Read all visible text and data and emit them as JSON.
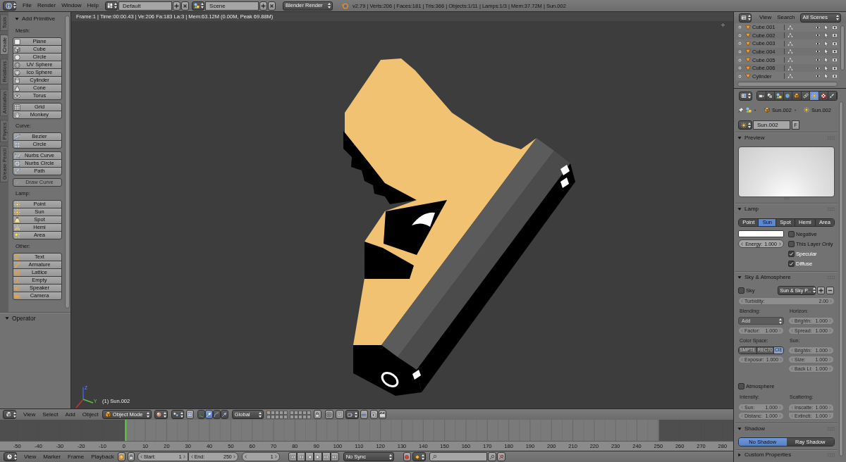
{
  "top_bar": {
    "menus": [
      "File",
      "Render",
      "Window",
      "Help"
    ],
    "screen_layout": "Default",
    "scene": "Scene",
    "render_engine": "Blender Render",
    "stats": "v2.79 | Verts:206 | Faces:181 | Tris:366 | Objects:1/11 | Lamps:1/3 | Mem:37.72M | Sun.002"
  },
  "tool_shelf": {
    "tabs": [
      {
        "label": "Tools",
        "selected": false
      },
      {
        "label": "Create",
        "selected": true
      },
      {
        "label": "Relations",
        "selected": false
      },
      {
        "label": "Animation",
        "selected": false
      },
      {
        "label": "Physics",
        "selected": false
      },
      {
        "label": "Grease Pencil",
        "selected": false
      }
    ],
    "add_primitive": {
      "title": "Add Primitive",
      "expanded": true,
      "groups": [
        {
          "label": "Mesh:",
          "blocks": [
            [
              {
                "label": "Plane",
                "disabled": false
              },
              {
                "label": "Cube",
                "disabled": false
              },
              {
                "label": "Circle",
                "disabled": false
              },
              {
                "label": "UV Sphere",
                "disabled": false
              },
              {
                "label": "Ico Sphere",
                "disabled": false
              },
              {
                "label": "Cylinder",
                "disabled": false
              },
              {
                "label": "Cone",
                "disabled": false
              },
              {
                "label": "Torus",
                "disabled": false
              }
            ],
            [
              {
                "label": "Grid",
                "disabled": false
              },
              {
                "label": "Monkey",
                "disabled": false
              }
            ]
          ]
        },
        {
          "label": "Curve:",
          "blocks": [
            [
              {
                "label": "Bezier",
                "disabled": false
              },
              {
                "label": "Circle",
                "disabled": false
              }
            ],
            [
              {
                "label": "Nurbs Curve",
                "disabled": false
              },
              {
                "label": "Nurbs Circle",
                "disabled": false
              },
              {
                "label": "Path",
                "disabled": false
              }
            ],
            [
              {
                "label": "Draw Curve",
                "disabled": true
              }
            ]
          ]
        },
        {
          "label": "Lamp:",
          "blocks": [
            [
              {
                "label": "Point",
                "disabled": false
              },
              {
                "label": "Sun",
                "disabled": false
              },
              {
                "label": "Spot",
                "disabled": false
              },
              {
                "label": "Hemi",
                "disabled": false
              },
              {
                "label": "Area",
                "disabled": false
              }
            ]
          ]
        },
        {
          "label": "Other:",
          "blocks": [
            [
              {
                "label": "Text",
                "disabled": false
              },
              {
                "label": "Armature",
                "disabled": false
              },
              {
                "label": "Lattice",
                "disabled": false
              },
              {
                "label": "Empty",
                "disabled": false
              },
              {
                "label": "Speaker",
                "disabled": false
              },
              {
                "label": "Camera",
                "disabled": false
              }
            ]
          ]
        }
      ]
    },
    "operator": {
      "title": "Operator",
      "expanded": true
    }
  },
  "viewport": {
    "info": "Frame:1 | Time:00:00.43 | Ve:206 Fa:183 La:3 | Mem:63.12M (0.00M, Peak 69.88M)",
    "axes": [
      "Z",
      "Y"
    ],
    "object_label": "(1) Sun.002"
  },
  "view3d_header": {
    "menus": [
      "View",
      "Select",
      "Add",
      "Object"
    ],
    "mode": "Object Mode",
    "toggles": [
      {
        "selected": false
      },
      {
        "selected": false
      },
      {
        "selected": true
      },
      {
        "selected": false
      },
      {
        "selected": false
      }
    ],
    "orientation": "Global",
    "layers": [
      {
        "occupied": true
      },
      {
        "occupied": false
      },
      {
        "occupied": false
      },
      {
        "occupied": false
      },
      {
        "occupied": false
      },
      {
        "occupied": false
      },
      {
        "occupied": false
      },
      {
        "occupied": false
      },
      {
        "occupied": false
      },
      {
        "occupied": false
      },
      {
        "occupied": false
      },
      {
        "occupied": false
      },
      {
        "occupied": false
      },
      {
        "occupied": false
      },
      {
        "occupied": false
      },
      {
        "occupied": false
      },
      {
        "occupied": false
      },
      {
        "occupied": false
      },
      {
        "occupied": false
      },
      {
        "occupied": false
      }
    ]
  },
  "timeline": {
    "ruler": [
      "-50",
      "-40",
      "-30",
      "-20",
      "-10",
      "0",
      "10",
      "20",
      "30",
      "40",
      "50",
      "60",
      "70",
      "80",
      "90",
      "100",
      "110",
      "120",
      "130",
      "140",
      "150",
      "160",
      "170",
      "180",
      "190",
      "200",
      "210",
      "220",
      "230",
      "240",
      "250",
      "260",
      "270",
      "280"
    ],
    "menus": [
      "View",
      "Marker",
      "Frame",
      "Playback"
    ],
    "start_label": "Start:",
    "start": "1",
    "end_label": "End:",
    "end": "250",
    "current": "1",
    "sync": "No Sync"
  },
  "outliner": {
    "menus": [
      "View",
      "Search"
    ],
    "filter": "All Scenes",
    "rows": [
      {
        "name": "Cube.001"
      },
      {
        "name": "Cube.002"
      },
      {
        "name": "Cube.003"
      },
      {
        "name": "Cube.004"
      },
      {
        "name": "Cube.005"
      },
      {
        "name": "Cube.006"
      },
      {
        "name": "Cylinder"
      }
    ]
  },
  "properties": {
    "tabs": [
      {
        "selected": false
      },
      {
        "selected": false
      },
      {
        "selected": false
      },
      {
        "selected": false
      },
      {
        "selected": false
      },
      {
        "selected": false
      },
      {
        "selected": true
      },
      {
        "selected": false
      },
      {
        "selected": false
      }
    ],
    "breadcrumb": [
      "Sun.002",
      "Sun.002"
    ],
    "datablock": {
      "name": "Sun.002",
      "fake_user": "F"
    },
    "preview": {
      "title": "Preview",
      "expanded": true
    },
    "lamp": {
      "title": "Lamp",
      "expanded": true,
      "types": [
        {
          "label": "Point",
          "selected": false
        },
        {
          "label": "Sun",
          "selected": true
        },
        {
          "label": "Spot",
          "selected": false
        },
        {
          "label": "Hemi",
          "selected": false
        },
        {
          "label": "Area",
          "selected": false
        }
      ],
      "color": "#ffffff",
      "energy": {
        "label": "Energy:",
        "value": "1.000"
      },
      "options": [
        {
          "label": "Negative",
          "checked": false
        },
        {
          "label": "This Layer Only",
          "checked": false
        },
        {
          "label": "Specular",
          "checked": true
        },
        {
          "label": "Diffuse",
          "checked": true
        }
      ]
    },
    "sky": {
      "title": "Sky & Atmosphere",
      "expanded": true,
      "sky": {
        "label": "Sky",
        "checked": false
      },
      "preset": "Sun & Sky P...",
      "turbidity": {
        "label": "Turbidity:",
        "value": "2.00"
      },
      "blending_label": "Blending:",
      "blend_mode": "Add",
      "factor": {
        "label": "Factor:",
        "value": "1.000"
      },
      "horizon_label": "Horizon:",
      "horizon": [
        {
          "label": "Brightn:",
          "value": "1.000"
        },
        {
          "label": "Spread:",
          "value": "1.000"
        }
      ],
      "color_space_label": "Color Space:",
      "color_spaces": [
        {
          "label": "SMPTE",
          "selected": false
        },
        {
          "label": "REC70",
          "selected": false
        },
        {
          "label": "CIE",
          "selected": true
        }
      ],
      "exposure": {
        "label": "Exposur:",
        "value": "1.000"
      },
      "sun_label": "Sun:",
      "sun": [
        {
          "label": "Brightn:",
          "value": "1.000"
        },
        {
          "label": "Size:",
          "value": "1.000"
        },
        {
          "label": "Back Li:",
          "value": "1.000"
        }
      ],
      "atmosphere": {
        "label": "Atmosphere",
        "checked": false
      },
      "intensity_label": "Intensity:",
      "intensity": [
        {
          "label": "Sun:",
          "value": "1.000"
        },
        {
          "label": "Distanc:",
          "value": "1.000"
        }
      ],
      "scattering_label": "Scattering:",
      "scattering": [
        {
          "label": "Inscatte:",
          "value": "1.000"
        },
        {
          "label": "Extincti:",
          "value": "1.000"
        }
      ]
    },
    "shadow": {
      "title": "Shadow",
      "expanded": true,
      "modes": [
        {
          "label": "No Shadow",
          "selected": true
        },
        {
          "label": "Ray Shadow",
          "selected": false
        }
      ]
    },
    "custom_properties": {
      "title": "Custom Properties",
      "expanded": false
    }
  }
}
